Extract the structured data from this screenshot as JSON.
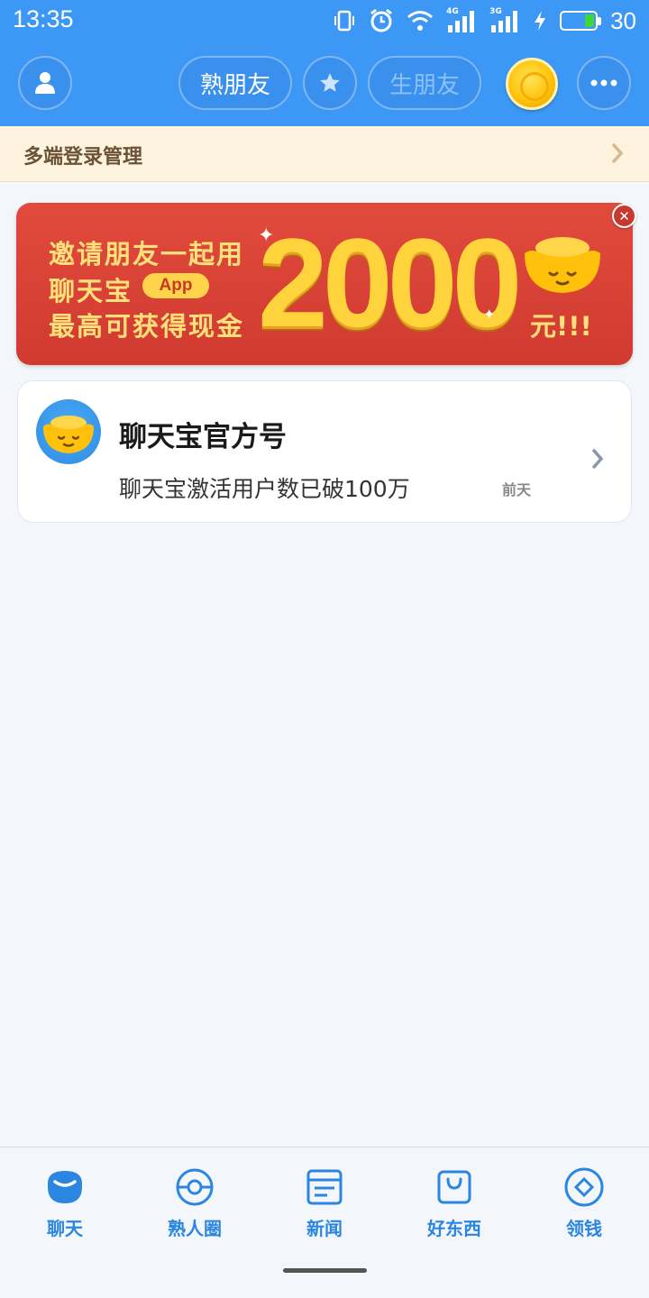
{
  "status_bar": {
    "time": "13:35",
    "net1": "4G",
    "net2": "3G",
    "battery": "30"
  },
  "header": {
    "friends_tab": "熟朋友",
    "strangers_tab": "生朋友",
    "profile_icon": "person-icon",
    "favorites_icon": "star-icon",
    "coin_icon": "gold-coin-icon",
    "more_icon": "more-dots-icon"
  },
  "login_bar": {
    "label": "多端登录管理"
  },
  "banner": {
    "line1": "邀请朋友一起用",
    "line2": "聊天宝",
    "app_badge": "App",
    "line3": "最高可获得现金",
    "amount": "2000",
    "unit": "元!!!"
  },
  "chats": [
    {
      "title": "聊天宝官方号",
      "message": "聊天宝激活用户数已破100万",
      "time": "前天"
    }
  ],
  "bottom_nav": [
    {
      "label": "聊天",
      "icon": "chat-icon"
    },
    {
      "label": "熟人圈",
      "icon": "circle-icon"
    },
    {
      "label": "新闻",
      "icon": "news-icon"
    },
    {
      "label": "好东西",
      "icon": "shopping-bag-icon"
    },
    {
      "label": "领钱",
      "icon": "diamond-icon"
    }
  ],
  "colors": {
    "primary": "#3d98f5",
    "accent": "#2a86e0",
    "banner_red": "#d13a30",
    "gold": "#ffd33b"
  }
}
